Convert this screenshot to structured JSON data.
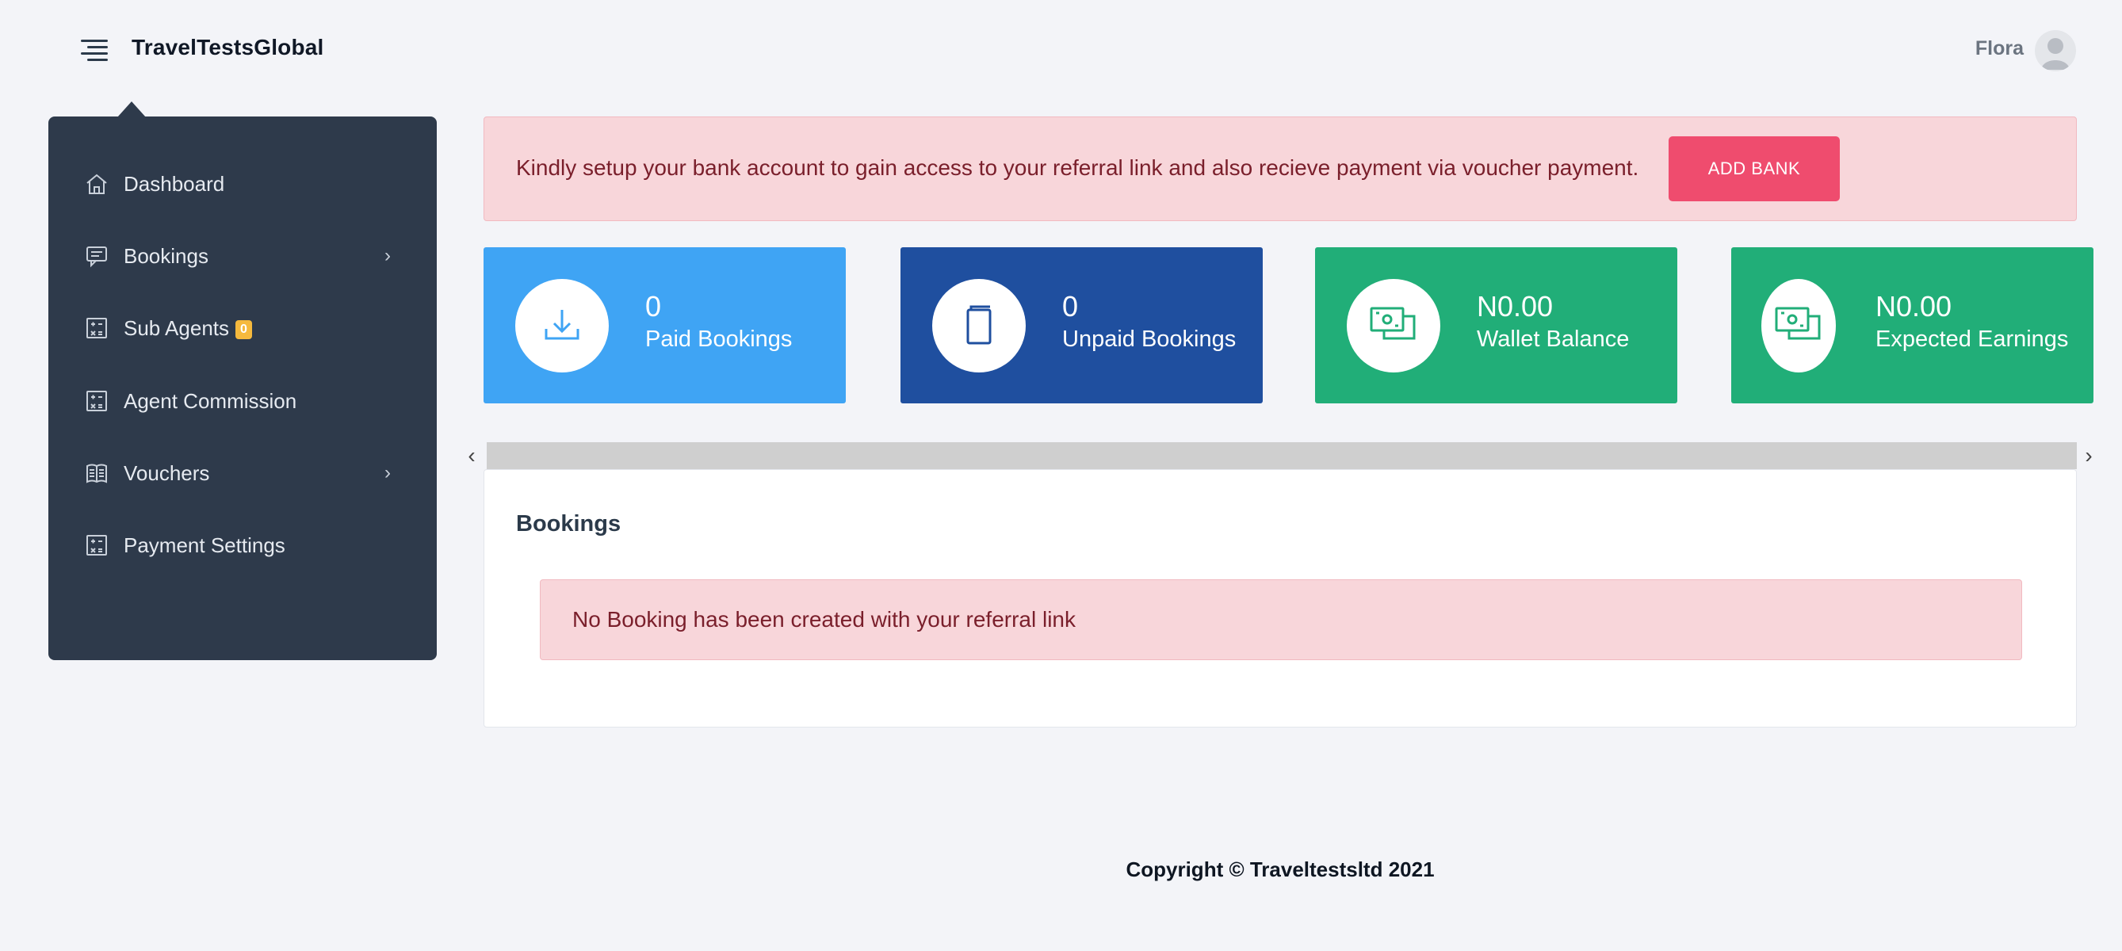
{
  "header": {
    "brand": "TravelTestsGlobal",
    "user_name": "Flora",
    "menu_icon": "hamburger-menu-icon",
    "avatar_icon": "user-avatar-icon"
  },
  "sidebar": {
    "items": [
      {
        "label": "Dashboard",
        "icon": "home-icon"
      },
      {
        "label": "Bookings",
        "icon": "chat-icon",
        "has_submenu": true
      },
      {
        "label": "Sub Agents",
        "icon": "calculator-icon",
        "badge": "0"
      },
      {
        "label": "Agent Commission",
        "icon": "calculator-icon"
      },
      {
        "label": "Vouchers",
        "icon": "book-icon",
        "has_submenu": true
      },
      {
        "label": "Payment Settings",
        "icon": "calculator-icon"
      }
    ]
  },
  "bank_alert": {
    "message": "Kindly setup your bank account to gain access to your referral link and also recieve payment via voucher payment.",
    "button_label": "ADD BANK"
  },
  "stats": [
    {
      "value": "0",
      "label": "Paid Bookings",
      "icon": "download-tray-icon",
      "color": "#3fa4f4"
    },
    {
      "value": "0",
      "label": "Unpaid Bookings",
      "icon": "book-icon",
      "color": "#1f4f9f"
    },
    {
      "value": "N0.00",
      "label": "Wallet Balance",
      "icon": "money-notes-icon",
      "color": "#21ae78"
    },
    {
      "value": "N0.00",
      "label": "Expected Earnings",
      "icon": "money-notes-icon",
      "color": "#21ae78"
    }
  ],
  "bookings_panel": {
    "title": "Bookings",
    "empty_message": "No Booking has been created with your referral link"
  },
  "footer": {
    "copyright": "Copyright © Traveltestsltd 2021"
  },
  "colors": {
    "sidebar_bg": "#2e3a4b",
    "alert_bg": "#f8d6da",
    "alert_text": "#7a1f2b",
    "button_bg": "#ef4c6e",
    "page_bg": "#f3f4f8"
  }
}
